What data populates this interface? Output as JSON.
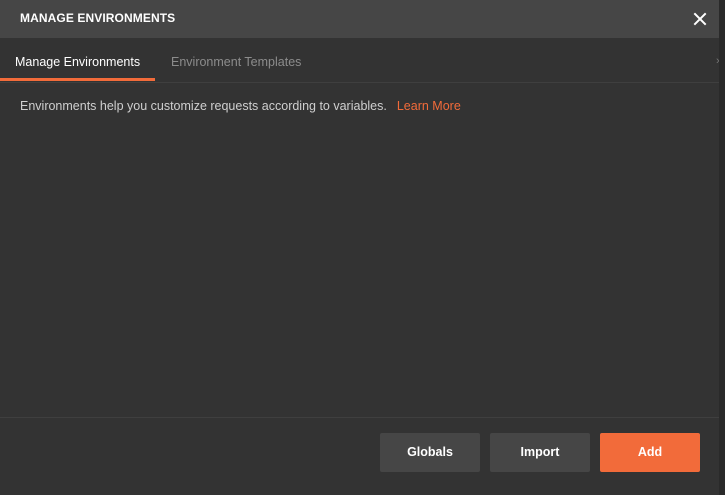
{
  "header": {
    "title": "MANAGE ENVIRONMENTS",
    "close_icon": "close-icon"
  },
  "tabs": [
    {
      "label": "Manage Environments",
      "active": true
    },
    {
      "label": "Environment Templates",
      "active": false
    }
  ],
  "info": {
    "text": "Environments help you customize requests according to variables.",
    "link_label": "Learn More"
  },
  "footer": {
    "globals_label": "Globals",
    "import_label": "Import",
    "add_label": "Add"
  },
  "colors": {
    "accent": "#f26b3a",
    "background": "#333333",
    "header": "#464646",
    "secondary_button": "#464646"
  }
}
